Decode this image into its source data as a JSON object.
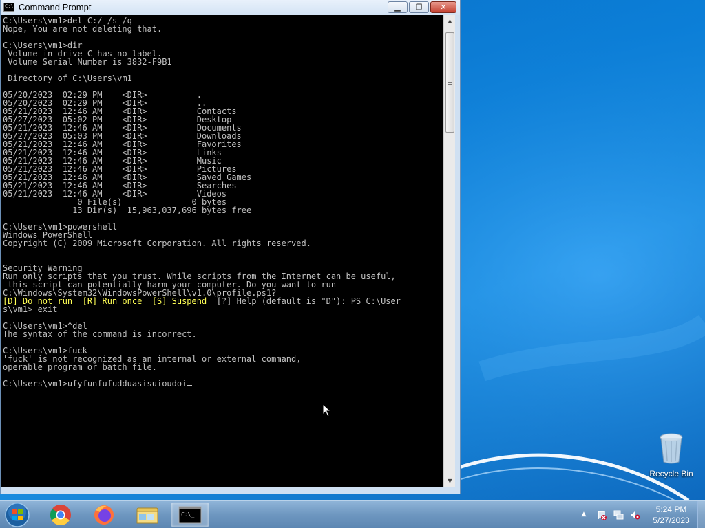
{
  "window": {
    "title": "Command Prompt",
    "icon_text": "C:\\",
    "minimize_label": "▁",
    "maximize_label": "❐",
    "close_label": "✕"
  },
  "console": {
    "lines_before": "C:\\Users\\vm1>del C:/ /s /q\nNope, You are not deleting that.\n\nC:\\Users\\vm1>dir\n Volume in drive C has no label.\n Volume Serial Number is 3832-F9B1\n\n Directory of C:\\Users\\vm1\n\n05/20/2023  02:29 PM    <DIR>          .\n05/20/2023  02:29 PM    <DIR>          ..\n05/21/2023  12:46 AM    <DIR>          Contacts\n05/27/2023  05:02 PM    <DIR>          Desktop\n05/21/2023  12:46 AM    <DIR>          Documents\n05/27/2023  05:03 PM    <DIR>          Downloads\n05/21/2023  12:46 AM    <DIR>          Favorites\n05/21/2023  12:46 AM    <DIR>          Links\n05/21/2023  12:46 AM    <DIR>          Music\n05/21/2023  12:46 AM    <DIR>          Pictures\n05/21/2023  12:46 AM    <DIR>          Saved Games\n05/21/2023  12:46 AM    <DIR>          Searches\n05/21/2023  12:46 AM    <DIR>          Videos\n               0 File(s)              0 bytes\n              13 Dir(s)  15,963,037,696 bytes free\n\nC:\\Users\\vm1>powershell\nWindows PowerShell\nCopyright (C) 2009 Microsoft Corporation. All rights reserved.\n\n\nSecurity Warning\nRun only scripts that you trust. While scripts from the Internet can be useful,\n this script can potentially harm your computer. Do you want to run\nC:\\Windows\\System32\\WindowsPowerShell\\v1.0\\profile.ps1?\n",
    "highlight_line": "[D] Do not run  [R] Run once  [S] Suspend",
    "after_highlight": "  [?] Help (default is \"D\"): PS C:\\User\ns\\vm1> exit\n\nC:\\Users\\vm1>^del\nThe syntax of the command is incorrect.\n\nC:\\Users\\vm1>fuck\n'fuck' is not recognized as an internal or external command,\noperable program or batch file.\n\n",
    "prompt_line": "C:\\Users\\vm1>ufyfunfufudduasisuioudoi"
  },
  "scrollbar": {
    "up_arrow": "▲",
    "down_arrow": "▼"
  },
  "desktop": {
    "recycle_bin_label": "Recycle Bin"
  },
  "taskbar": {
    "items": [
      {
        "name": "start-button",
        "icon": "windows-orb-icon"
      },
      {
        "name": "chrome",
        "icon": "chrome-icon"
      },
      {
        "name": "firefox",
        "icon": "firefox-icon"
      },
      {
        "name": "explorer",
        "icon": "folder-icon"
      },
      {
        "name": "command-prompt",
        "icon": "cmd-icon",
        "active": true
      }
    ],
    "tray": {
      "show_hidden": "▲",
      "icons": [
        "action-center-icon",
        "network-icon",
        "volume-muted-icon"
      ]
    },
    "clock": {
      "time": "5:24 PM",
      "date": "5/27/2023"
    }
  },
  "colors": {
    "console_text": "#c0c0c0",
    "console_highlight": "#ffff55",
    "console_bg": "#000000"
  }
}
